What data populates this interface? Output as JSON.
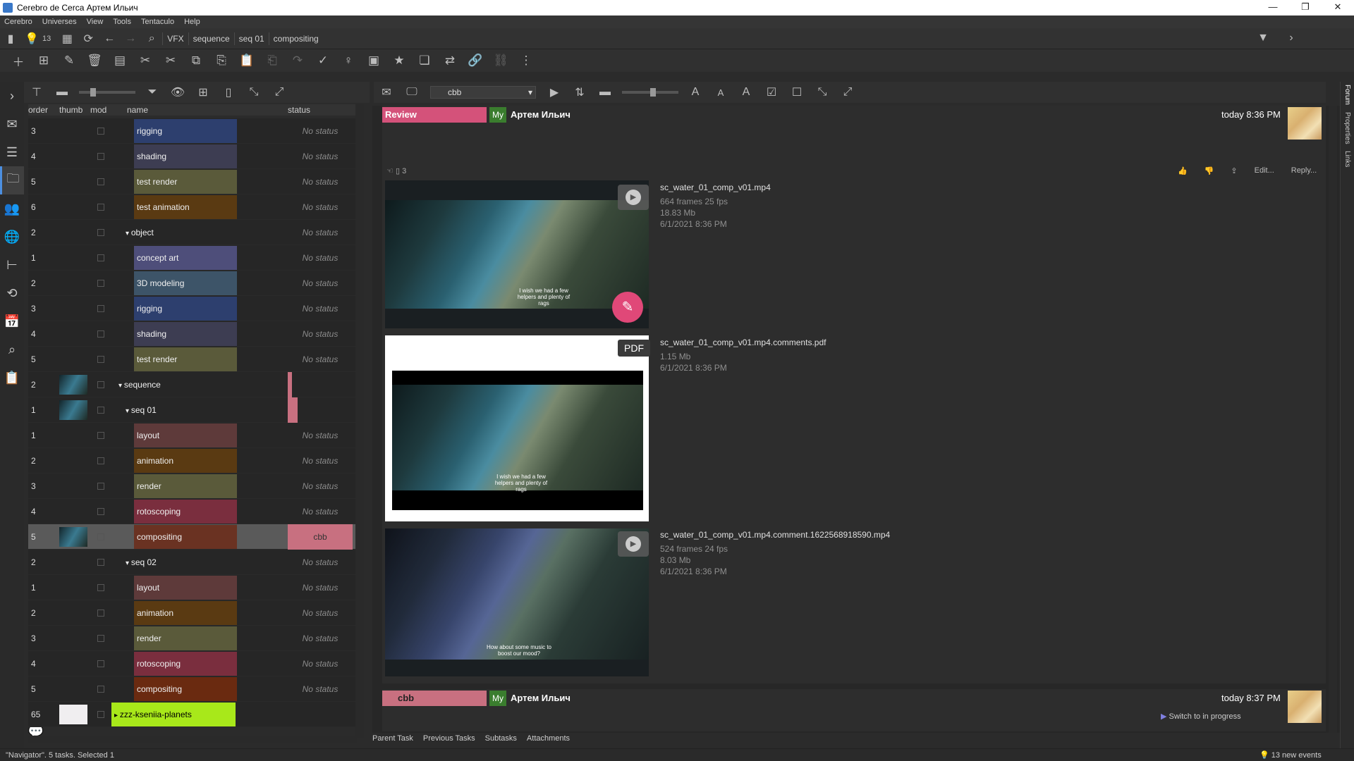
{
  "window": {
    "title": "Cerebro de Cerca  Артем Ильич",
    "controls": [
      "—",
      "❐",
      "✕"
    ]
  },
  "menu": [
    "Cerebro",
    "Universes",
    "View",
    "Tools",
    "Tentaculo",
    "Help"
  ],
  "nav": {
    "event_count": "13",
    "breadcrumbs": [
      "VFX",
      "sequence",
      "seq 01",
      "compositing"
    ]
  },
  "tree": {
    "columns": {
      "order": "order",
      "thumb": "thumb",
      "mod": "mod",
      "name": "name",
      "status": "status"
    },
    "rows": [
      {
        "order": "3",
        "name": "rigging",
        "status": "No status",
        "color": "#2d3f6e",
        "indent": 0
      },
      {
        "order": "4",
        "name": "shading",
        "status": "No status",
        "color": "#3d3d52",
        "indent": 0
      },
      {
        "order": "5",
        "name": "test render",
        "status": "No status",
        "color": "#5a5a3a",
        "indent": 0
      },
      {
        "order": "6",
        "name": "test animation",
        "status": "No status",
        "color": "#5a3a12",
        "indent": 0
      },
      {
        "order": "2",
        "name": "object",
        "status": "No status",
        "color": "",
        "indent": 1
      },
      {
        "order": "1",
        "name": "concept art",
        "status": "No status",
        "color": "#4e4e7a",
        "indent": 0
      },
      {
        "order": "2",
        "name": "3D modeling",
        "status": "No status",
        "color": "#3d5468",
        "indent": 0
      },
      {
        "order": "3",
        "name": "rigging",
        "status": "No status",
        "color": "#2d3f6e",
        "indent": 0
      },
      {
        "order": "4",
        "name": "shading",
        "status": "No status",
        "color": "#3d3d52",
        "indent": 0
      },
      {
        "order": "5",
        "name": "test render",
        "status": "No status",
        "color": "#5a5a3a",
        "indent": 0
      },
      {
        "order": "2",
        "name": "sequence",
        "status": "",
        "color": "",
        "indent": 2
      },
      {
        "order": "1",
        "name": "seq 01",
        "status": "",
        "color": "",
        "indent": 1
      },
      {
        "order": "1",
        "name": "layout",
        "status": "No status",
        "color": "#5e3a3a",
        "indent": 0
      },
      {
        "order": "2",
        "name": "animation",
        "status": "No status",
        "color": "#5a3a12",
        "indent": 0
      },
      {
        "order": "3",
        "name": "render",
        "status": "No status",
        "color": "#5a5a3a",
        "indent": 0
      },
      {
        "order": "4",
        "name": "rotoscoping",
        "status": "No status",
        "color": "#7a2e3e",
        "indent": 0
      },
      {
        "order": "5",
        "name": "compositing",
        "status": "cbb",
        "color": "#6a3222",
        "indent": 0,
        "selected": true
      },
      {
        "order": "2",
        "name": "seq 02",
        "status": "No status",
        "color": "",
        "indent": 1
      },
      {
        "order": "1",
        "name": "layout",
        "status": "No status",
        "color": "#5e3a3a",
        "indent": 0
      },
      {
        "order": "2",
        "name": "animation",
        "status": "No status",
        "color": "#5a3a12",
        "indent": 0
      },
      {
        "order": "3",
        "name": "render",
        "status": "No status",
        "color": "#5a5a3a",
        "indent": 0
      },
      {
        "order": "4",
        "name": "rotoscoping",
        "status": "No status",
        "color": "#7a2e3e",
        "indent": 0
      },
      {
        "order": "5",
        "name": "compositing",
        "status": "No status",
        "color": "#6a2a10",
        "indent": 0
      },
      {
        "order": "65",
        "name": "zzz-kseniia-planets",
        "status": "",
        "color": "#a8e81a",
        "indent": 3
      }
    ]
  },
  "forum": {
    "status_filter": "cbb",
    "post1": {
      "tag": "Review",
      "my": "My",
      "author": "Артем Ильич",
      "time": "today 8:36 PM",
      "attach_count": "3",
      "actions": [
        "Edit...",
        "Reply..."
      ],
      "attachments": [
        {
          "name": "sc_water_01_comp_v01.mp4",
          "meta": [
            "664 frames 25 fps",
            "18.83 Mb",
            "6/1/2021 8:36 PM"
          ],
          "kind": "video",
          "subtitle": "I wish we had a few helpers and plenty of rags"
        },
        {
          "name": "sc_water_01_comp_v01.mp4.comments.pdf",
          "meta": [
            "1.15 Mb",
            "6/1/2021 8:36 PM"
          ],
          "kind": "PDF",
          "subtitle": "I wish we had a few helpers and plenty of rags"
        },
        {
          "name": "sc_water_01_comp_v01.mp4.comment.1622568918590.mp4",
          "meta": [
            "524 frames 24 fps",
            "8.03 Mb",
            "6/1/2021 8:36 PM"
          ],
          "kind": "video",
          "subtitle": "How about some music to boost our mood?"
        }
      ]
    },
    "post2": {
      "tag": "cbb",
      "my": "My",
      "author": "Артем Ильич",
      "time": "today 8:37 PM",
      "action": "Switch to in progress"
    }
  },
  "right_tabs": [
    "Forum",
    "Properties",
    "Links"
  ],
  "bottom_tabs": [
    "Parent Task",
    "Previous Tasks",
    "Subtasks",
    "Attachments"
  ],
  "status_bar": {
    "left": "\"Navigator\". 5 tasks. Selected 1",
    "right": "13 new events"
  },
  "colors": {
    "review": "#d4527a",
    "cbb": "#c87080",
    "my": "#3a7d2e",
    "accent": "#4c8fe0"
  }
}
